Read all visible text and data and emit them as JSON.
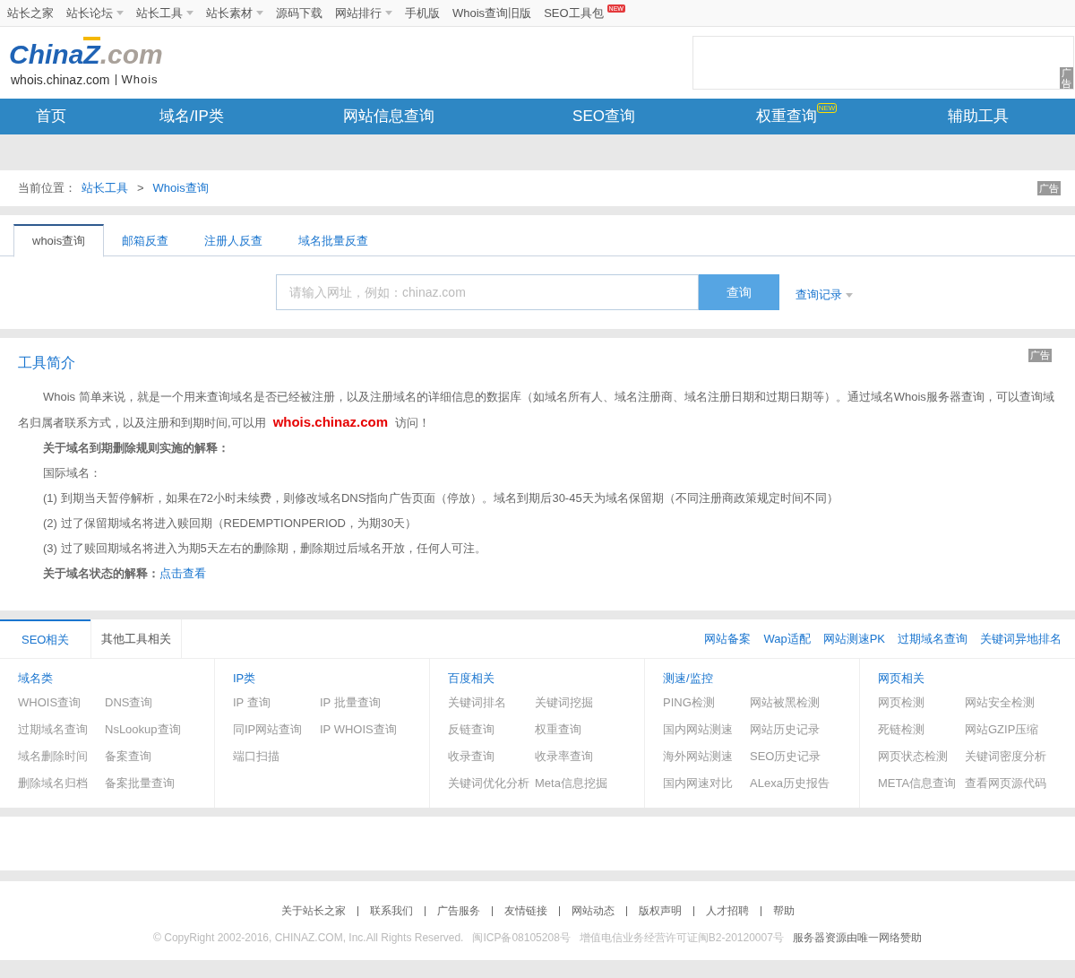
{
  "top_nav": [
    {
      "label": "站长之家",
      "dropdown": false
    },
    {
      "label": "站长论坛",
      "dropdown": true
    },
    {
      "label": "站长工具",
      "dropdown": true
    },
    {
      "label": "站长素材",
      "dropdown": true
    },
    {
      "label": "源码下载",
      "dropdown": false
    },
    {
      "label": "网站排行",
      "dropdown": true
    },
    {
      "label": "手机版",
      "dropdown": false
    },
    {
      "label": "Whois查询旧版",
      "dropdown": false
    },
    {
      "label": "SEO工具包",
      "dropdown": false,
      "badge": "NEW"
    }
  ],
  "logo": {
    "brand": "China",
    "brand_mark": "Z",
    "brand_suffix": ".com",
    "domain": "whois.chinaz.com",
    "section": "Whois"
  },
  "header_ad": {
    "label": "广告"
  },
  "main_nav": [
    {
      "label": "首页"
    },
    {
      "label": "域名/IP类"
    },
    {
      "label": "网站信息查询"
    },
    {
      "label": "SEO查询"
    },
    {
      "label": "权重查询",
      "badge": "NEW"
    },
    {
      "label": "辅助工具"
    }
  ],
  "breadcrumb": {
    "prefix": "当前位置：",
    "items": [
      "站长工具",
      "Whois查询"
    ],
    "separator": ">",
    "ad": "广告"
  },
  "tabs": [
    {
      "label": "whois查询",
      "selected": true
    },
    {
      "label": "邮箱反查",
      "selected": false
    },
    {
      "label": "注册人反查",
      "selected": false
    },
    {
      "label": "域名批量反查",
      "selected": false
    }
  ],
  "search": {
    "placeholder": "请输入网址，例如：chinaz.com",
    "button": "查询",
    "history": "查询记录"
  },
  "intro": {
    "title": "工具简介",
    "ad": "广告",
    "paragraphs": [
      {
        "kind": "lead",
        "before": "Whois 简单来说，就是一个用来查询域名是否已经被注册，以及注册域名的详细信息的数据库（如域名所有人、域名注册商、域名注册日期和过期日期等）。通过域名Whois服务器查询，可以查询域名归属者联系方式，以及注册和到期时间,可以用",
        "link": "whois.chinaz.com",
        "after": "访问！"
      },
      {
        "kind": "heading",
        "text": "关于域名到期删除规则实施的解释："
      },
      {
        "kind": "text",
        "text": "国际域名："
      },
      {
        "kind": "text",
        "text": "(1) 到期当天暂停解析，如果在72小时未续费，则修改域名DNS指向广告页面（停放）。域名到期后30-45天为域名保留期（不同注册商政策规定时间不同）"
      },
      {
        "kind": "text",
        "text": "(2) 过了保留期域名将进入赎回期（REDEMPTIONPERIOD，为期30天）"
      },
      {
        "kind": "text",
        "text": "(3) 过了赎回期域名将进入为期5天左右的删除期，删除期过后域名开放，任何人可注。"
      },
      {
        "kind": "heading_link",
        "text": "关于域名状态的解释：",
        "link": "点击查看"
      }
    ]
  },
  "tools": {
    "tabs": [
      {
        "label": "SEO相关",
        "selected": true
      },
      {
        "label": "其他工具相关",
        "selected": false
      }
    ],
    "quick_links": [
      "网站备案",
      "Wap适配",
      "网站测速PK",
      "过期域名查询",
      "关键词异地排名"
    ],
    "columns": [
      {
        "title": "域名类",
        "items": [
          "WHOIS查询",
          "DNS查询",
          "过期域名查询",
          "NsLookup查询",
          "域名删除时间",
          "备案查询",
          "删除域名归档",
          "备案批量查询"
        ]
      },
      {
        "title": "IP类",
        "items": [
          "IP 查询",
          "IP 批量查询",
          "同IP网站查询",
          "IP WHOIS查询",
          "端口扫描"
        ]
      },
      {
        "title": "百度相关",
        "items": [
          "关键词排名",
          "关键词挖掘",
          "反链查询",
          "权重查询",
          "收录查询",
          "收录率查询",
          "关键词优化分析",
          "Meta信息挖掘"
        ]
      },
      {
        "title": "测速/监控",
        "items": [
          "PING检测",
          "网站被黑检测",
          "国内网站测速",
          "网站历史记录",
          "海外网站测速",
          "SEO历史记录",
          "国内网速对比",
          "ALexa历史报告"
        ]
      },
      {
        "title": "网页相关",
        "items": [
          "网页检测",
          "网站安全检测",
          "死链检测",
          "网站GZIP压缩",
          "网页状态检测",
          "关键词密度分析",
          "META信息查询",
          "查看网页源代码"
        ]
      }
    ]
  },
  "footer": {
    "links": [
      "关于站长之家",
      "联系我们",
      "广告服务",
      "友情链接",
      "网站动态",
      "版权声明",
      "人才招聘",
      "帮助"
    ],
    "copyright": "© CopyRight 2002-2016, CHINAZ.COM, Inc.All Rights Reserved.",
    "icp": "闽ICP备08105208号",
    "license": "增值电信业务经营许可证闽B2-20120007号",
    "sponsor": "服务器资源由唯一网络赞助"
  }
}
